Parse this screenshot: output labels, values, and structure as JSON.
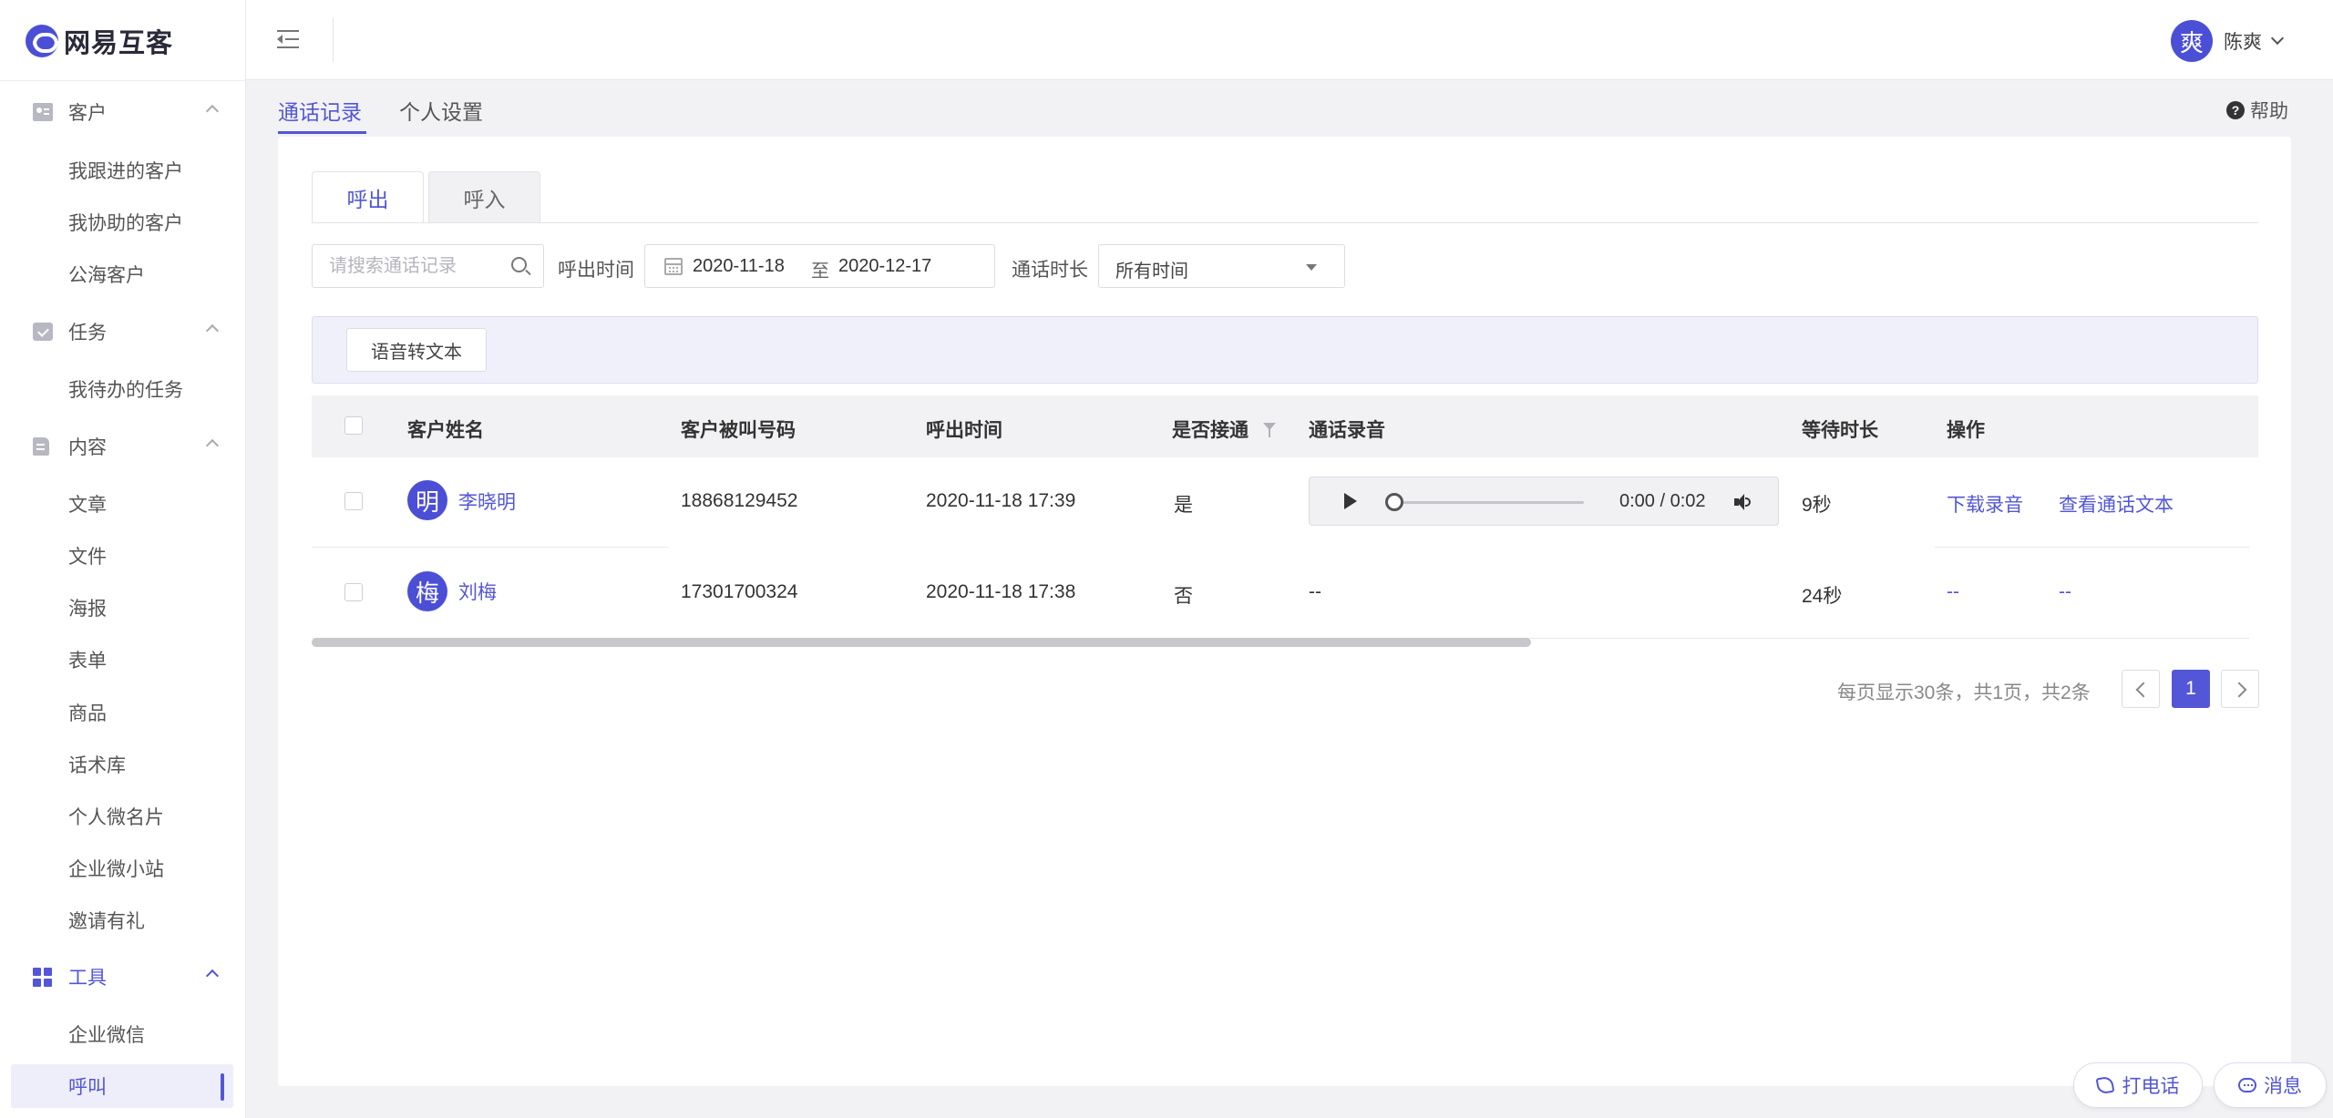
{
  "app": {
    "logo_text": "网易互客"
  },
  "header": {
    "user_avatar_char": "爽",
    "user_name": "陈爽"
  },
  "sidebar": {
    "groups": [
      {
        "label": "客户",
        "icon": "id-card-icon",
        "items": [
          "我跟进的客户",
          "我协助的客户",
          "公海客户"
        ]
      },
      {
        "label": "任务",
        "icon": "task-icon",
        "items": [
          "我待办的任务"
        ]
      },
      {
        "label": "内容",
        "icon": "document-icon",
        "items": [
          "文章",
          "文件",
          "海报",
          "表单",
          "商品",
          "话术库",
          "个人微名片",
          "企业微小站",
          "邀请有礼"
        ]
      },
      {
        "label": "工具",
        "icon": "grid-icon",
        "items": [
          "企业微信",
          "呼叫"
        ]
      }
    ],
    "active_item": "呼叫"
  },
  "page_tabs": {
    "call_records": "通话记录",
    "personal_settings": "个人设置",
    "help": "帮助"
  },
  "sub_tabs": {
    "outgoing": "呼出",
    "incoming": "呼入"
  },
  "filters": {
    "search_placeholder": "请搜索通话记录",
    "call_time_label": "呼出时间",
    "date_start": "2020-11-18",
    "date_separator": "至",
    "date_end": "2020-12-17",
    "duration_label": "通话时长",
    "duration_value": "所有时间"
  },
  "toolbar": {
    "speech_to_text": "语音转文本"
  },
  "table": {
    "columns": [
      "客户姓名",
      "客户被叫号码",
      "呼出时间",
      "是否接通",
      "通话录音",
      "等待时长",
      "操作"
    ],
    "rows": [
      {
        "avatar": "明",
        "name": "李晓明",
        "phone": "18868129452",
        "time": "2020-11-18 17:39",
        "connected": "是",
        "recording": "0:00 / 0:02",
        "wait": "9秒",
        "op1": "下载录音",
        "op2": "查看通话文本"
      },
      {
        "avatar": "梅",
        "name": "刘梅",
        "phone": "17301700324",
        "time": "2020-11-18 17:38",
        "connected": "否",
        "recording": "--",
        "wait": "24秒",
        "op1": "--",
        "op2": "--"
      }
    ]
  },
  "pagination": {
    "summary": "每页显示30条，共1页，共2条",
    "current": "1"
  },
  "floating": {
    "call": "打电话",
    "message": "消息"
  },
  "colors": {
    "accent": "#5356d6",
    "background": "#f2f2f4"
  }
}
